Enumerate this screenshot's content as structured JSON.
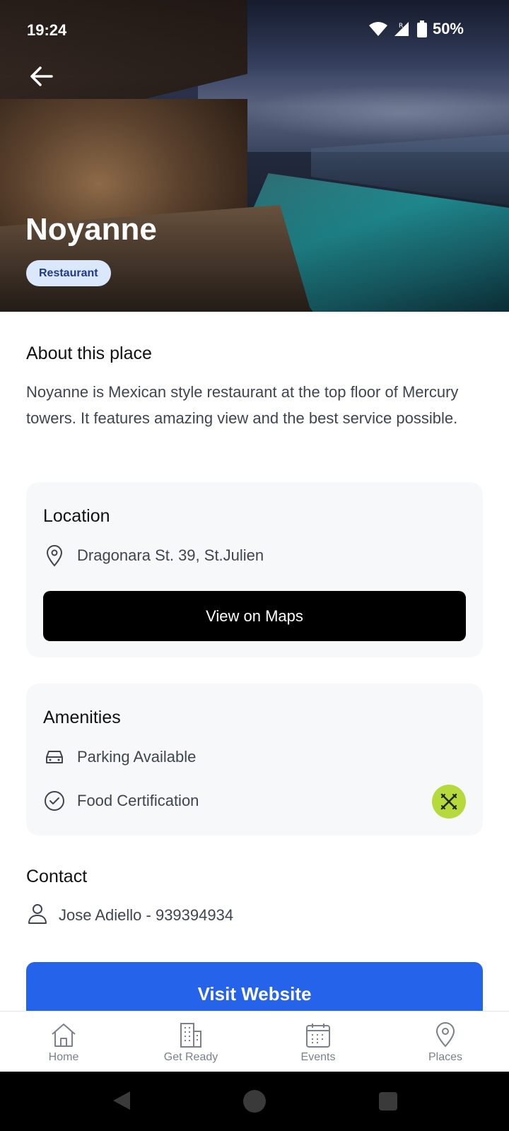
{
  "status_bar": {
    "time": "19:24",
    "battery": "50%"
  },
  "place": {
    "name": "Noyanne",
    "category": "Restaurant"
  },
  "about": {
    "title": "About this place",
    "text": "Noyanne is Mexican style restaurant at the top floor of Mercury towers. It features amazing view and the best service possible."
  },
  "location": {
    "title": "Location",
    "address": "Dragonara St. 39, St.Julien",
    "maps_button": "View on Maps"
  },
  "amenities": {
    "title": "Amenities",
    "items": [
      {
        "label": "Parking Available",
        "icon": "car-icon"
      },
      {
        "label": "Food Certification",
        "icon": "check-circle-icon"
      }
    ]
  },
  "contact": {
    "title": "Contact",
    "person": "Jose Adiello - 939394934"
  },
  "website_button": "Visit Website",
  "nav": [
    {
      "label": "Home",
      "icon": "home-icon"
    },
    {
      "label": "Get Ready",
      "icon": "building-icon"
    },
    {
      "label": "Events",
      "icon": "calendar-icon"
    },
    {
      "label": "Places",
      "icon": "location-pin-icon"
    }
  ],
  "colors": {
    "primary": "#2563eb",
    "badge_bg": "#dbe7fb",
    "fab": "#b6d93b",
    "card_bg": "#f7f8fa"
  }
}
